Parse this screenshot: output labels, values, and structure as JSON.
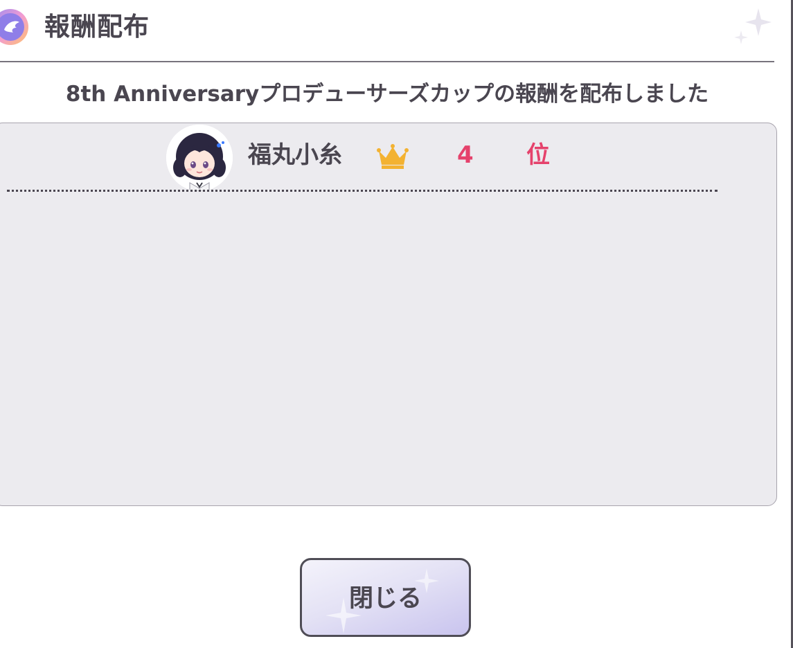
{
  "dialog": {
    "title": "報酬配布",
    "title_icon": "angel-wing-badge-icon",
    "decoration_icon": "sparkle-icon"
  },
  "message": "8th Anniversaryプロデューサーズカップの報酬を配布しました",
  "reward": {
    "idol_name": "福丸小糸",
    "rank_icon": "crown-icon",
    "rank_number": "4",
    "rank_suffix": "位",
    "avatar_icon": "idol-avatar-icon"
  },
  "close_button": {
    "label": "閉じる"
  },
  "colors": {
    "text": "#4a4650",
    "rank": "#e5426c",
    "crown": "#f3b232",
    "panel_bg": "#ecebef",
    "button_gradient_end": "#c9c4ee"
  }
}
